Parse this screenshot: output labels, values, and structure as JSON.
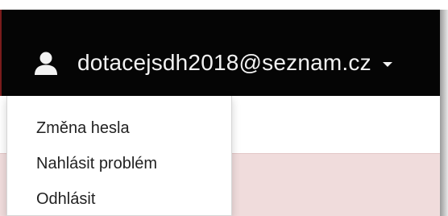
{
  "navbar": {
    "user_icon": "user-icon",
    "user_email": "dotacejsdh2018@seznam.cz",
    "caret_icon": "caret-down-icon"
  },
  "user_menu": {
    "items": [
      {
        "label": "Změna hesla"
      },
      {
        "label": "Nahlásit problém"
      },
      {
        "label": "Odhlásit"
      }
    ]
  },
  "colors": {
    "navbar_bg": "#050505",
    "text_light": "#f2f2f2",
    "panel_pink": "#f0dcdc",
    "menu_text": "#222222"
  }
}
